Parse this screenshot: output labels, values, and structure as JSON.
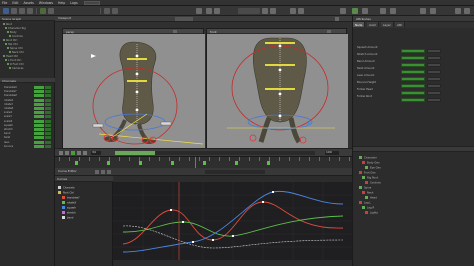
{
  "menubar": {
    "menus": [
      "File",
      "Edit",
      "Assets",
      "Windows",
      "Help",
      "Logs"
    ]
  },
  "toolbar": {
    "labels": [
      "Select",
      "Move",
      "Rotate",
      "Scale",
      "Pivot"
    ]
  },
  "left_panel": {
    "header": "Scene Graph",
    "tree": [
      "Root",
      "Character Rig",
      "Body",
      "Controls",
      "Root Ctrl",
      "Hip Ctrl",
      "Spine Ctrl",
      "Neck Ctrl",
      "Head Ctrl",
      "L Foot Ctrl",
      "R Foot Ctrl",
      "Cameras"
    ],
    "list_header": "Channels",
    "list_items": [
      "translateX",
      "translateY",
      "translateZ",
      "rotateX",
      "rotateY",
      "rotateZ",
      "scaleX",
      "scaleY",
      "scaleZ",
      "squash",
      "stretch",
      "bend",
      "twist",
      "lean",
      "bounce"
    ]
  },
  "viewport": {
    "header_label": "Viewport",
    "left_label": "persp",
    "right_label": "front"
  },
  "transport": {
    "frame": "34",
    "end_frame": "100"
  },
  "right_panel": {
    "tabs": [
      "Node",
      "Anim",
      "Layer",
      "Attr"
    ],
    "title": "Attributes",
    "rows": [
      "Squash Amount",
      "Stretch Amount",
      "Bend Amount",
      "Twist Amount",
      "Lean Amount",
      "Bounce Height",
      "Follow Head",
      "Follow Root"
    ],
    "outline_items": [
      "Character",
      "Body Geo",
      "Eye Geo",
      "Foot Geo",
      "Rig Root",
      "Controls",
      "Spine",
      "Neck",
      "Head",
      "Leg L",
      "Leg R",
      "Lights"
    ]
  },
  "bottom": {
    "toolbar_label": "Curve Editor",
    "outliner_header": "Curves",
    "outliner_items": [
      "Channels",
      "Root Ctrl",
      "translateY",
      "rotateX",
      "squash",
      "stretch",
      "bend"
    ]
  }
}
